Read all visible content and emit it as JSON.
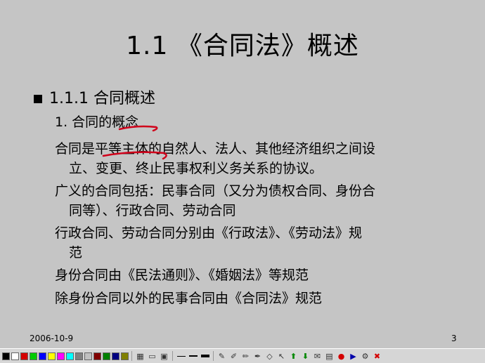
{
  "slide": {
    "title": "1.1 《合同法》概述",
    "heading": "1.1.1 合同概述",
    "item1_prefix": "1. 合同的",
    "item1_highlight": "概念",
    "p1_a": "合同是",
    "p1_highlight": "平等主体",
    "p1_b": "的自然人、法人、其他经济组织之间设",
    "p1_c": "立、变更、终止民事权利义务关系的协议。",
    "p2_a": "广义的合同包括：民事合同（又分为债权合同、身份合",
    "p2_b": "同等）、行政合同、劳动合同",
    "p3_a": "行政合同、劳动合同分别由《行政法》、《劳动法》规",
    "p3_b": "范",
    "p4": "身份合同由《民法通则》、《婚姻法》等规范",
    "p5": "除身份合同以外的民事合同由《合同法》规范",
    "date": "2006-10-9",
    "page": "3"
  },
  "annotation_color": "#d0001a",
  "toolbar": {
    "colors": [
      "#000000",
      "#ffffff",
      "#d40000",
      "#00cc00",
      "#0000ff",
      "#ffff00",
      "#ff00ff",
      "#00ffff",
      "#808080",
      "#c0c0c0",
      "#800000",
      "#008000",
      "#000080",
      "#808000"
    ],
    "icons": [
      "palette-icon",
      "monitor-icon",
      "screen-icon",
      "thin-line-icon",
      "medium-line-icon",
      "thick-line-icon",
      "pen-icon",
      "highlighter-icon",
      "brush-icon",
      "marker-icon",
      "eraser-icon",
      "pointer-icon",
      "arrow-up-icon",
      "arrow-down-icon",
      "mail-icon",
      "save-icon",
      "record-icon",
      "play-icon",
      "settings-icon",
      "exit-icon"
    ]
  }
}
